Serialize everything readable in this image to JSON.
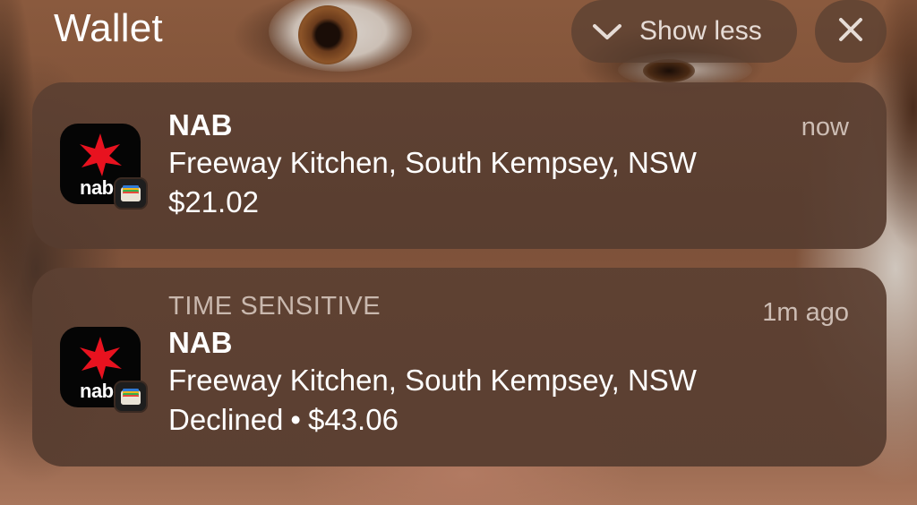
{
  "header": {
    "title": "Wallet",
    "show_less_label": "Show less"
  },
  "notifications": [
    {
      "app_brand": "nab",
      "category": "",
      "title": "NAB",
      "time": "now",
      "merchant": "Freeway Kitchen, South Kempsey, NSW",
      "status": "",
      "amount": "$21.02"
    },
    {
      "app_brand": "nab",
      "category": "TIME SENSITIVE",
      "title": "NAB",
      "time": "1m ago",
      "merchant": "Freeway Kitchen, South Kempsey, NSW",
      "status": "Declined",
      "separator": "•",
      "amount": "$43.06"
    }
  ],
  "icons": {
    "show_less": "chevron-down-icon",
    "close": "close-icon",
    "app": "nab-star-icon",
    "wallet_badge": "wallet-icon"
  },
  "colors": {
    "nab_red": "#e8121f",
    "card_bg": "#5c4032"
  }
}
